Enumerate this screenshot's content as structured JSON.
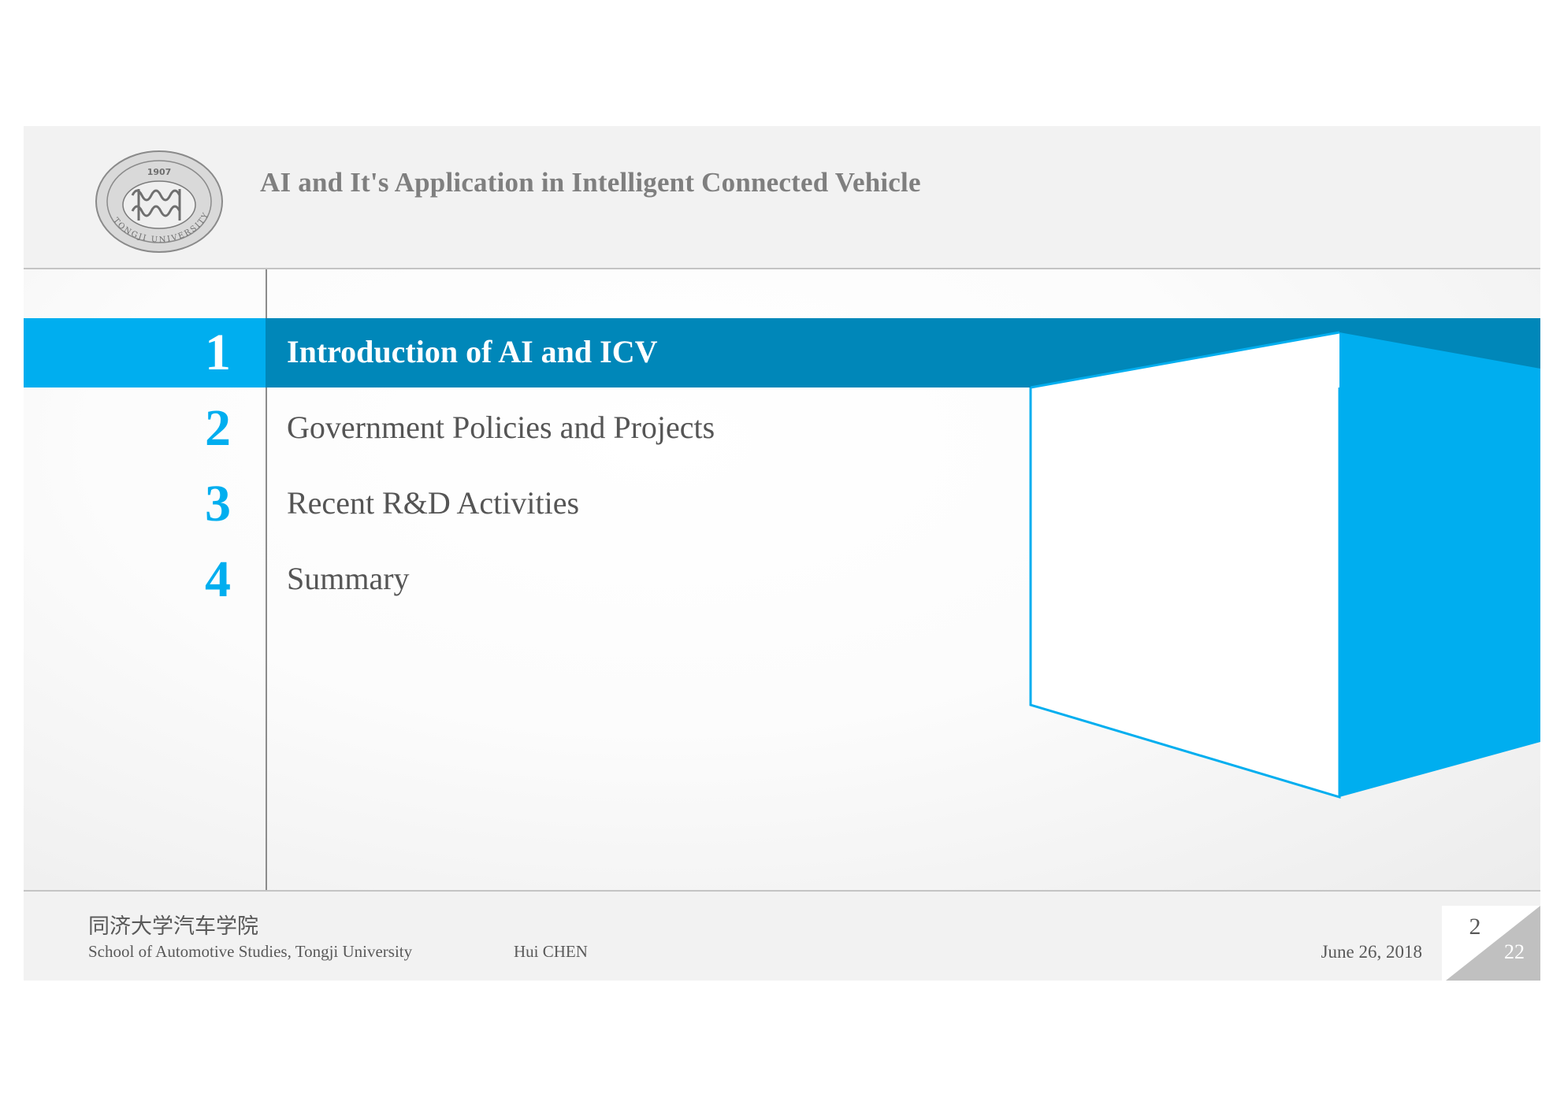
{
  "header": {
    "title": "AI and It's Application in Intelligent Connected Vehicle",
    "logo": {
      "name": "tongji-university-seal",
      "text_year": "1907",
      "text_name": "TONGJI UNIVERSITY"
    }
  },
  "agenda": {
    "items": [
      {
        "number": "1",
        "label": "Introduction of AI and ICV",
        "active": true
      },
      {
        "number": "2",
        "label": "Government Policies and Projects",
        "active": false
      },
      {
        "number": "3",
        "label": "Recent R&D Activities",
        "active": false
      },
      {
        "number": "4",
        "label": "Summary",
        "active": false
      }
    ]
  },
  "footer": {
    "school_cn": "同济大学汽车学院",
    "school_en": "School of Automotive Studies, Tongji University",
    "author": "Hui CHEN",
    "date": "June 26, 2018",
    "page": "2",
    "total_pages": "22"
  },
  "colors": {
    "accent_light": "#00aeef",
    "accent_dark": "#0087b9",
    "header_bg": "#f2f2f2",
    "text_gray": "#7f7f7f"
  }
}
